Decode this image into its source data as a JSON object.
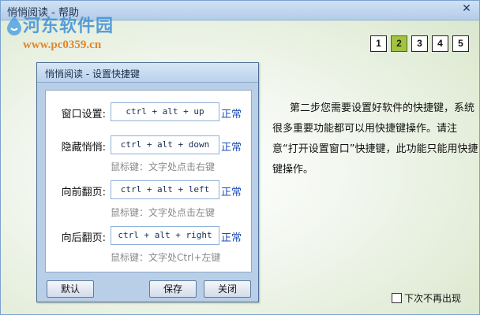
{
  "window": {
    "title": "悄悄阅读 - 帮助"
  },
  "watermark": {
    "site_name": "河东软件园",
    "url": "www.pc0359.cn"
  },
  "pager": {
    "pages": [
      "1",
      "2",
      "3",
      "4",
      "5"
    ],
    "current": "2"
  },
  "description": "第二步您需要设置好软件的快捷键，系统很多重要功能都可以用快捷键操作。请注意“打开设置窗口”快捷键，此功能只能用快捷键操作。",
  "dialog": {
    "title": "悄悄阅读 - 设置快捷键",
    "rows": [
      {
        "label": "窗口设置:",
        "hotkey": "ctrl + alt + up",
        "status": "正常",
        "hint": ""
      },
      {
        "label": "隐藏悄悄:",
        "hotkey": "ctrl + alt + down",
        "status": "正常",
        "hint": "鼠标键：文字处点击右键"
      },
      {
        "label": "向前翻页:",
        "hotkey": "ctrl + alt + left",
        "status": "正常",
        "hint": "鼠标键：文字处点击左键"
      },
      {
        "label": "向后翻页:",
        "hotkey": "ctrl + alt + right",
        "status": "正常",
        "hint": "鼠标键：文字处Ctrl+左键"
      }
    ],
    "buttons": {
      "default": "默认",
      "save": "保存",
      "close": "关闭"
    }
  },
  "dont_show_again": {
    "label": "下次不再出现",
    "checked": false
  }
}
